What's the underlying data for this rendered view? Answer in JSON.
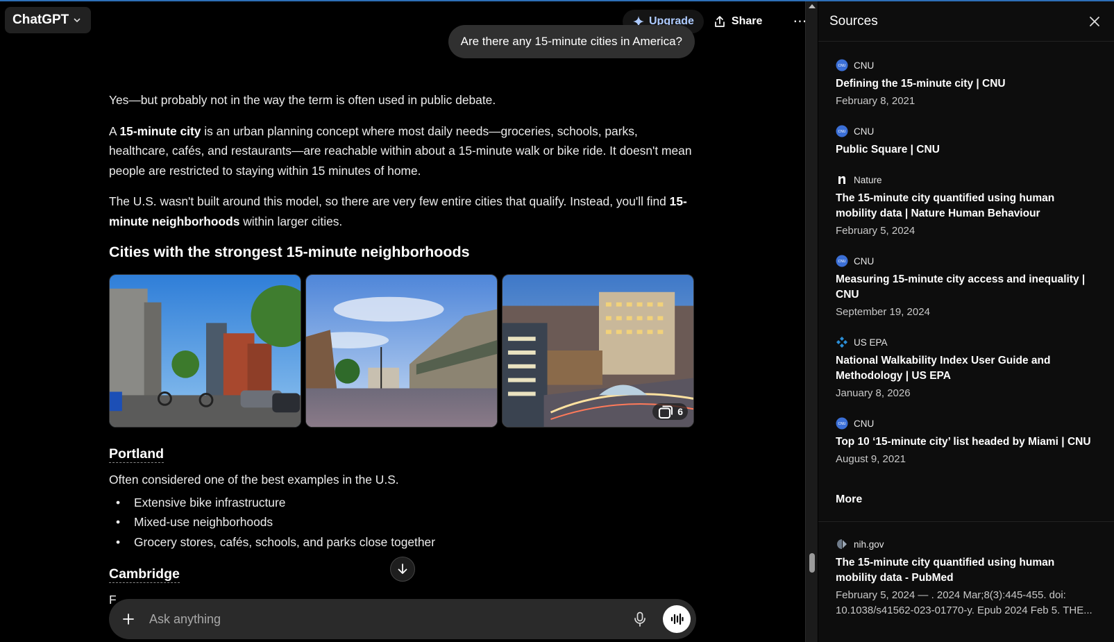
{
  "header": {
    "model_name": "ChatGPT",
    "upgrade_label": "Upgrade",
    "share_label": "Share",
    "more_label": "⋯"
  },
  "conversation": {
    "user_message": "Are there any 15-minute cities in America?",
    "answer": {
      "intro": "Yes—but probably not in the way the term is often used in public debate.",
      "p2_prefix": "A ",
      "p2_bold": "15-minute city",
      "p2_rest": " is an urban planning concept where most daily needs—groceries, schools, parks, healthcare, cafés, and restaurants—are reachable within about a 15-minute walk or bike ride. It doesn't mean people are restricted to staying within 15 minutes of home.",
      "p3_prefix": "The U.S. wasn't built around this model, so there are very few entire cities that qualify. Instead, you'll find ",
      "p3_bold": "15-minute neighborhoods",
      "p3_rest": " within larger cities.",
      "section_heading": "Cities with the strongest 15-minute neighborhoods",
      "gallery_more_count": "6",
      "cities": [
        {
          "name": "Portland",
          "description": "Often considered one of the best examples in the U.S.",
          "bullets": [
            "Extensive bike infrastructure",
            "Mixed-use neighborhoods",
            "Grocery stores, cafés, schools, and parks close together"
          ]
        },
        {
          "name": "Cambridge",
          "description_partial": "F"
        }
      ]
    }
  },
  "composer": {
    "placeholder": "Ask anything"
  },
  "sources_panel": {
    "title": "Sources",
    "items": [
      {
        "site": "CNU",
        "title": "Defining the 15-minute city | CNU",
        "date": "February 8, 2021",
        "icon": "cnu-icon"
      },
      {
        "site": "CNU",
        "title": "Public Square | CNU",
        "date": "",
        "icon": "cnu-icon"
      },
      {
        "site": "Nature",
        "title": "The 15-minute city quantified using human mobility data | Nature Human Behaviour",
        "date": "February 5, 2024",
        "icon": "nature-icon"
      },
      {
        "site": "CNU",
        "title": "Measuring 15-minute city access and inequality | CNU",
        "date": "September 19, 2024",
        "icon": "cnu-icon"
      },
      {
        "site": "US EPA",
        "title": "National Walkability Index User Guide and Methodology | US EPA",
        "date": "January 8, 2026",
        "icon": "epa-icon"
      },
      {
        "site": "CNU",
        "title": "Top 10 ‘15-minute city’ list headed by Miami | CNU",
        "date": "August 9, 2021",
        "icon": "cnu-icon"
      }
    ],
    "more_heading": "More",
    "more_items": [
      {
        "site": "nih.gov",
        "title": "The 15-minute city quantified using human mobility data - PubMed",
        "snippet_line1": "February 5, 2024 — . 2024 Mar;8(3):445-455. doi:",
        "snippet_line2": "10.1038/s41562-023-01770-y. Epub 2024 Feb 5. THE...",
        "icon": "nih-icon"
      }
    ]
  },
  "colors": {
    "accent_upgrade": "#aecbff",
    "background": "#000000",
    "panel": "#0d0d0d",
    "bubble": "#303030"
  }
}
